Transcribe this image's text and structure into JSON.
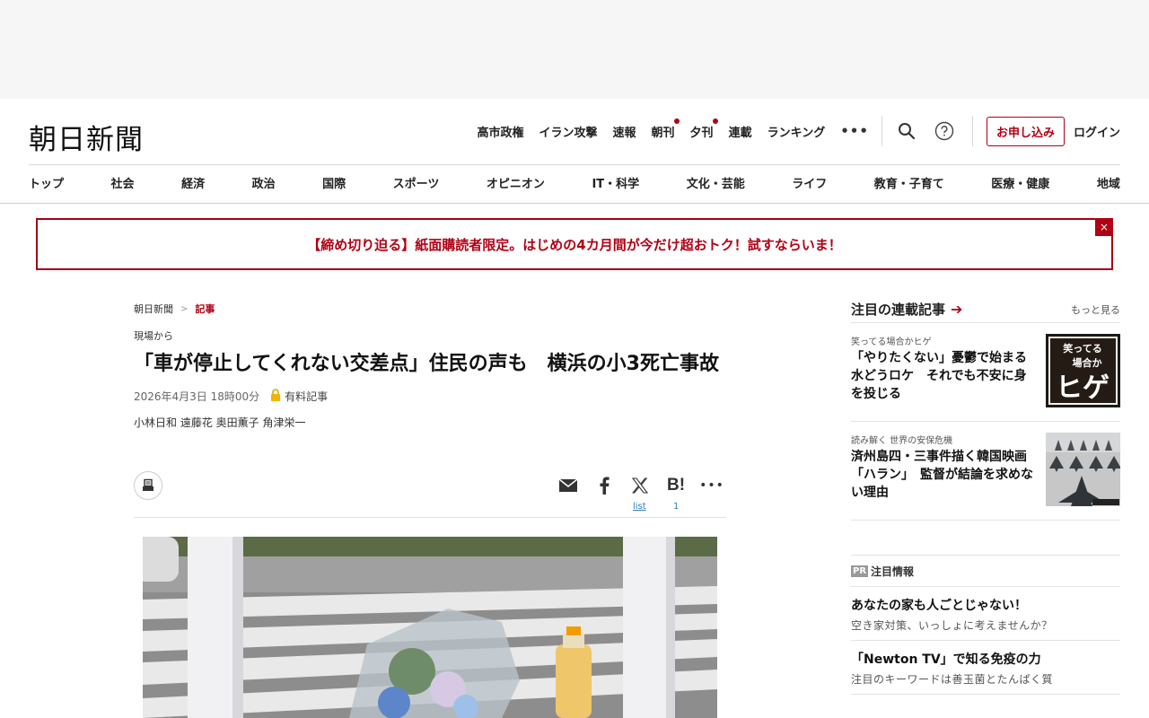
{
  "header": {
    "logo": "朝日新聞",
    "top_links": [
      {
        "label": "高市政権",
        "dot": false
      },
      {
        "label": "イラン攻撃",
        "dot": false
      },
      {
        "label": "速報",
        "dot": false
      },
      {
        "label": "朝刊",
        "dot": true
      },
      {
        "label": "夕刊",
        "dot": true
      },
      {
        "label": "連載",
        "dot": false
      },
      {
        "label": "ランキング",
        "dot": false
      }
    ],
    "more": "•••",
    "subscribe": "お申し込み",
    "login": "ログイン",
    "icons": [
      "search-icon",
      "help-icon"
    ]
  },
  "nav": [
    "トップ",
    "社会",
    "経済",
    "政治",
    "国際",
    "スポーツ",
    "オピニオン",
    "IT・科学",
    "文化・芸能",
    "ライフ",
    "教育・子育て",
    "医療・健康",
    "地域"
  ],
  "promo": {
    "text": "【締め切り迫る】紙面購読者限定。はじめの4カ月間が今だけ超おトク！試すならいま！",
    "close": "×"
  },
  "article": {
    "breadcrumb": [
      "朝日新聞",
      "記事"
    ],
    "section": "現場から",
    "headline": "「車が停止してくれない交差点」住民の声も　横浜の小3死亡事故",
    "date": "2026年4月3日 18時00分",
    "paid_label": "有料記事",
    "authors": "小林日和 遠藤花 奥田薫子 角津栄一",
    "share": {
      "x_count": "list",
      "hatena_count": "1",
      "icons": [
        "print-icon",
        "mail-icon",
        "facebook-icon",
        "x-icon",
        "hatena-icon",
        "more-icon"
      ]
    }
  },
  "sidebar": {
    "title": "注目の連載記事",
    "more": "もっと見る",
    "items": [
      {
        "kicker": "笑ってる場合かヒゲ",
        "title": "「やりたくない」憂鬱で始まる水どうロケ　それでも不安に身を投じる",
        "thumb_text": "笑ってる場合かヒゲ"
      },
      {
        "kicker": "読み解く 世界の安保危機",
        "title": "済州島四・三事件描く韓国映画「ハラン」　監督が結論を求めない理由",
        "thumb_text": ""
      }
    ]
  },
  "pr": {
    "badge": "PR",
    "title": "注目情報",
    "items": [
      {
        "title": "あなたの家も人ごとじゃない！",
        "desc": "空き家対策、いっしょに考えませんか？"
      },
      {
        "title": "「Newton TV」で知る免疫の力",
        "desc": "注目のキーワードは善玉菌とたんぱく質"
      }
    ]
  },
  "colors": {
    "accent": "#b10014",
    "link": "#2c7cc1"
  }
}
